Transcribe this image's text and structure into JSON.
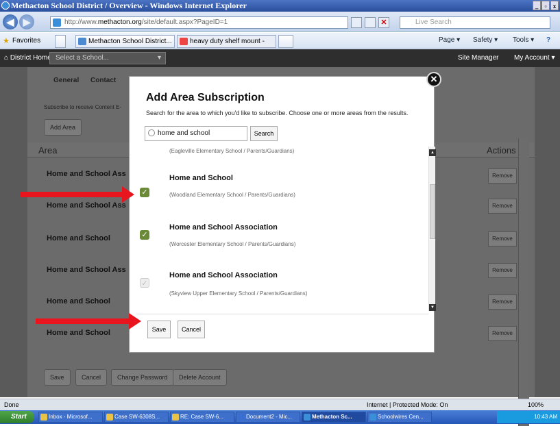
{
  "window": {
    "title": "Methacton School District / Overview - Windows Internet Explorer"
  },
  "address": {
    "url_prefix": "http://www.",
    "url_domain": "methacton.org",
    "url_path": "/site/default.aspx?PageID=1",
    "search_placeholder": "Live Search"
  },
  "favorites": {
    "label": "Favorites",
    "tabs": [
      "Methacton School District...",
      "heavy duty shelf mount - Go..."
    ],
    "commands": [
      "Page ▾",
      "Safety ▾",
      "Tools ▾"
    ]
  },
  "sitenav": {
    "home": "District Home",
    "select_school": "Select a School...",
    "site_manager": "Site Manager",
    "my_account": "My Account"
  },
  "background": {
    "tabs": [
      "General",
      "Contact"
    ],
    "subscribe_text": "Subscribe to receive Content E-",
    "add_area": "Add Area",
    "area_header": "Area",
    "actions_header": "Actions",
    "rows": [
      "Home and School Ass",
      "Home and School Ass",
      "Home and School",
      "Home and School Ass",
      "Home and School",
      "Home and School"
    ],
    "remove_label": "Remove",
    "bottom_buttons": [
      "Save",
      "Cancel",
      "Change Password",
      "Delete Account"
    ]
  },
  "modal": {
    "title": "Add Area Subscription",
    "description": "Search for the area to which you'd like to subscribe. Choose one or more areas from the results.",
    "search_value": "home and school",
    "search_button": "Search",
    "results": [
      {
        "name": "",
        "path": "(Eagleville Elementary School / Parents/Guardians)",
        "checked": true
      },
      {
        "name": "Home and School",
        "path": "(Woodland Elementary School / Parents/Guardians)",
        "checked": true
      },
      {
        "name": "Home and School Association",
        "path": "(Worcester Elementary School / Parents/Guardians)",
        "checked": true
      },
      {
        "name": "Home and School Association",
        "path": "(Skyview Upper Elementary School / Parents/Guardians)",
        "checked": false
      }
    ],
    "save": "Save",
    "cancel": "Cancel"
  },
  "status": {
    "left": "Done",
    "zone": "Internet | Protected Mode: On",
    "zoom": "100%"
  },
  "taskbar": {
    "start": "Start",
    "items": [
      "Inbox - Microsof...",
      "Case SW-6308S...",
      "RE: Case SW-6...",
      "Document2 - Mic...",
      "Methacton Sc...",
      "Schoolwires Cen..."
    ],
    "clock": "10:43 AM"
  },
  "colors": {
    "accent_checkbox": "#6a8a38",
    "arrow": "#e8141e"
  }
}
